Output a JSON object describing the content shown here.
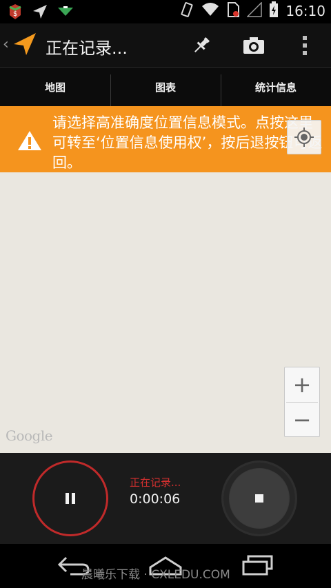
{
  "status_bar": {
    "time": "16:10",
    "icons": [
      "app-notification-icon",
      "navigation-arrow-icon",
      "download-icon",
      "vibrate-icon",
      "wifi-icon",
      "no-sim-icon",
      "signal-icon",
      "battery-charging-icon"
    ]
  },
  "action_bar": {
    "title": "正在记录...",
    "actions": [
      "pin-icon",
      "camera-icon",
      "overflow-menu-icon"
    ]
  },
  "tabs": [
    {
      "label": "地图"
    },
    {
      "label": "图表"
    },
    {
      "label": "统计信息"
    }
  ],
  "warning": {
    "text": "请选择高准确度位置信息模式。点按这里可转至‘位置信息使用权’，按后退按钮可返回。"
  },
  "map": {
    "zoom_in": "+",
    "zoom_out": "−",
    "attribution": "Google"
  },
  "controls": {
    "status": "正在记录...",
    "elapsed": "0:00:06"
  },
  "nav": {
    "watermark": "晨曦乐下载 · CXLEDU.COM"
  },
  "colors": {
    "warning_bg": "#f5941e",
    "accent_orange": "#f59a1e",
    "record_red": "#d3302f",
    "map_bg": "#eae7e0"
  }
}
